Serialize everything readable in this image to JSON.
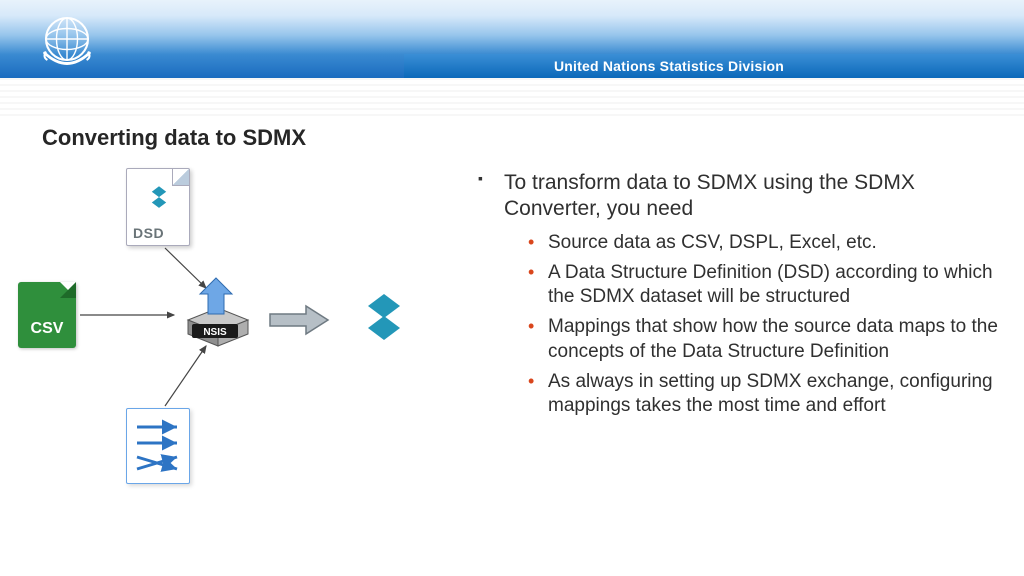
{
  "header": {
    "org": "United Nations Statistics Division"
  },
  "title": "Converting data to SDMX",
  "diagram": {
    "dsd_label": "DSD",
    "csv_label": "CSV",
    "nsis_label": "NSIS"
  },
  "bullets": {
    "main": "To transform data to SDMX using the SDMX Converter, you need",
    "subs": [
      "Source data as CSV, DSPL, Excel, etc.",
      "A Data Structure Definition (DSD) according to which the SDMX dataset will be structured",
      "Mappings that show how the source data maps to the concepts of the Data Structure Definition",
      "As always in setting up SDMX exchange, configuring mappings takes the most time and effort"
    ]
  }
}
